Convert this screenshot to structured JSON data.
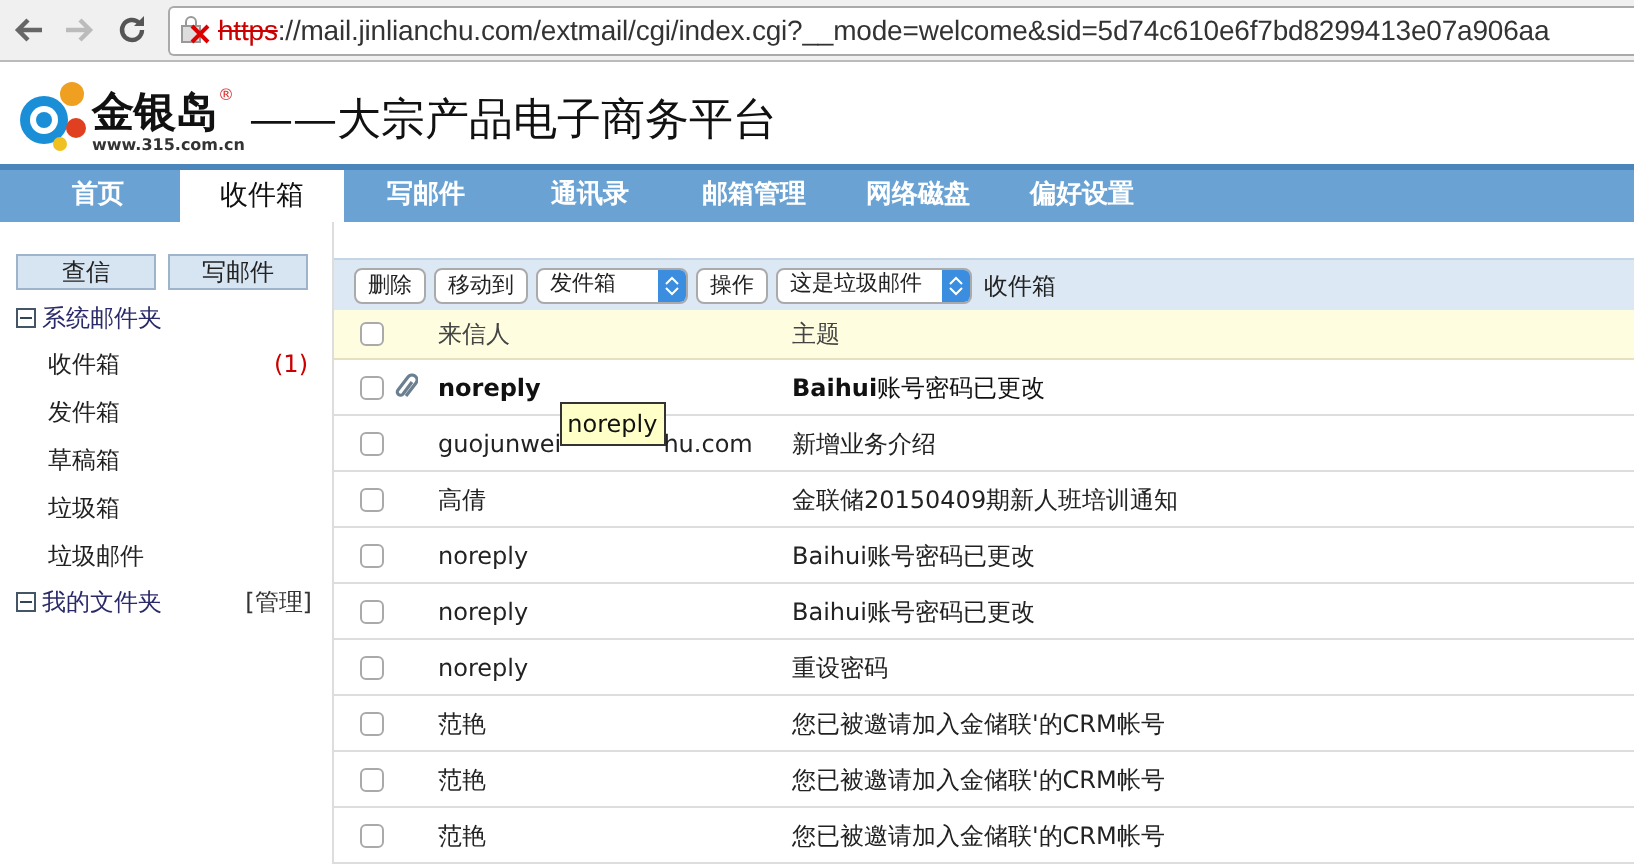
{
  "browser": {
    "url_scheme": "https",
    "url_rest": "://mail.jinlianchu.com/extmail/cgi/index.cgi?__mode=welcome&sid=5d74c610e6f7bd8299413e07a906aa"
  },
  "logo": {
    "name": "金银岛",
    "mark": "®",
    "site": "www.315.com.cn",
    "slogan": "——大宗产品电子商务平台"
  },
  "nav": [
    {
      "label": "首页",
      "selected": false
    },
    {
      "label": "收件箱",
      "selected": true
    },
    {
      "label": "写邮件",
      "selected": false
    },
    {
      "label": "通讯录",
      "selected": false
    },
    {
      "label": "邮箱管理",
      "selected": false
    },
    {
      "label": "网络磁盘",
      "selected": false
    },
    {
      "label": "偏好设置",
      "selected": false
    }
  ],
  "sidebar": {
    "buttons": [
      "查信",
      "写邮件"
    ],
    "groups": [
      {
        "label": "系统邮件夹",
        "expanded": true,
        "children": [
          {
            "label": "收件箱",
            "count": "(1)"
          },
          {
            "label": "发件箱"
          },
          {
            "label": "草稿箱"
          },
          {
            "label": "垃圾箱"
          },
          {
            "label": "垃圾邮件"
          }
        ]
      },
      {
        "label": "我的文件夹",
        "expanded": true,
        "action": "[管理]"
      }
    ]
  },
  "toolbar": {
    "delete": "删除",
    "move": "移动到",
    "move_target": "发件箱",
    "operate": "操作",
    "operation": "这是垃圾邮件",
    "folder": "收件箱"
  },
  "table": {
    "select_all_checked": false,
    "columns": [
      "来信人",
      "主题"
    ],
    "rows": [
      {
        "sender": "noreply",
        "subject": "**Baihui**账号密码已更改",
        "unread": true,
        "attachment": true,
        "checked": false
      },
      {
        "sender": "guojunwei",
        "sender_tail": "hu.com",
        "tooltip": "noreply",
        "subject": "新增业务介绍",
        "unread": false,
        "attachment": false,
        "checked": false
      },
      {
        "sender": "高倩",
        "subject": "金联储20150409期新人班培训通知",
        "unread": false,
        "attachment": false,
        "checked": false
      },
      {
        "sender": "noreply",
        "subject": "Baihui账号密码已更改",
        "unread": false,
        "attachment": false,
        "checked": false
      },
      {
        "sender": "noreply",
        "subject": "Baihui账号密码已更改",
        "unread": false,
        "attachment": false,
        "checked": false
      },
      {
        "sender": "noreply",
        "subject": "重设密码",
        "unread": false,
        "attachment": false,
        "checked": false
      },
      {
        "sender": "范艳",
        "subject": "您已被邀请加入金储联'的CRM帐号",
        "unread": false,
        "attachment": false,
        "checked": false
      },
      {
        "sender": "范艳",
        "subject": "您已被邀请加入金储联'的CRM帐号",
        "unread": false,
        "attachment": false,
        "checked": false
      },
      {
        "sender": "范艳",
        "subject": "您已被邀请加入金储联'的CRM帐号",
        "unread": false,
        "attachment": false,
        "checked": false
      }
    ]
  }
}
